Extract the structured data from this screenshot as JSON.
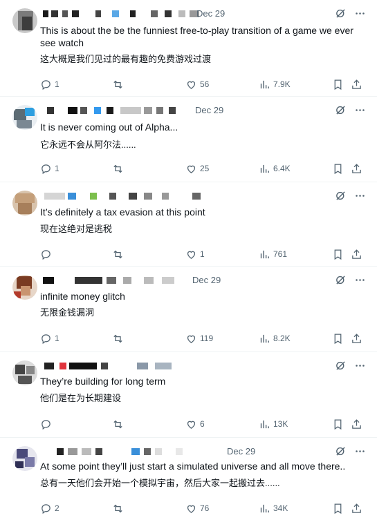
{
  "replies": [
    {
      "date": "Dec 29",
      "text_en": "This is about the be the funniest free-to-play transition of a game we ever see watch",
      "text_cn": "这大概是我们见过的最有趣的免费游戏过渡",
      "reply_count": "1",
      "retweet_count": "",
      "like_count": "56",
      "view_count": "7.9K"
    },
    {
      "date": "Dec 29",
      "text_en": "It is never coming out of Alpha...",
      "text_cn": "它永远不会从阿尔法......",
      "reply_count": "1",
      "retweet_count": "",
      "like_count": "25",
      "view_count": "6.4K"
    },
    {
      "date": "",
      "text_en": "It’s definitely a tax evasion at this point",
      "text_cn": "现在这绝对是逃税",
      "reply_count": "",
      "retweet_count": "",
      "like_count": "1",
      "view_count": "761"
    },
    {
      "date": "Dec 29",
      "text_en": "infinite money glitch",
      "text_cn": "无限金钱漏洞",
      "reply_count": "1",
      "retweet_count": "",
      "like_count": "119",
      "view_count": "8.2K"
    },
    {
      "date": "",
      "text_en": "They’re building for long term",
      "text_cn": "他们是在为长期建设",
      "reply_count": "",
      "retweet_count": "",
      "like_count": "6",
      "view_count": "13K"
    },
    {
      "date": "Dec 29",
      "text_en": "At some point they’ll just start a simulated universe and all move there..",
      "text_cn": "总有一天他们会开始一个模拟宇宙，然后大家一起搬过去......",
      "reply_count": "2",
      "retweet_count": "",
      "like_count": "76",
      "view_count": "34K"
    }
  ],
  "icons": {
    "grok": "grok-icon",
    "more": "more-icon",
    "reply": "reply-icon",
    "retweet": "retweet-icon",
    "like": "like-icon",
    "views": "views-icon",
    "bookmark": "bookmark-icon",
    "share": "share-icon"
  },
  "colors": {
    "text": "#0f1419",
    "muted": "#536471",
    "divider": "#eff3f4"
  }
}
